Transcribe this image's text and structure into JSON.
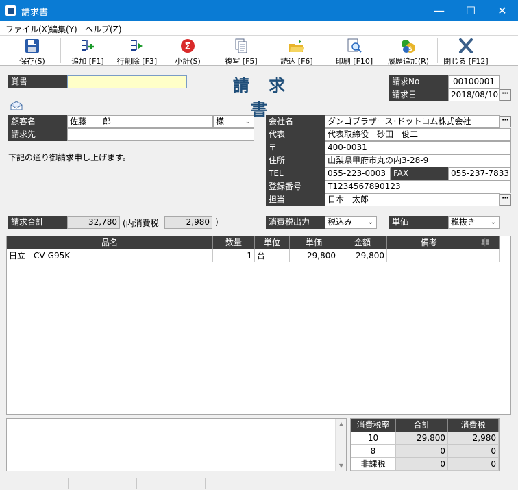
{
  "window": {
    "title": "請求書"
  },
  "menu": [
    "ファイル(X)",
    "編集(Y)",
    "ヘルプ(Z)"
  ],
  "toolbar": [
    {
      "label": "保存(S)",
      "icon": "save-icon"
    },
    {
      "label": "追加 [F1]",
      "icon": "add-row-icon"
    },
    {
      "label": "行削除 [F3]",
      "icon": "delete-row-icon"
    },
    {
      "label": "小計(S)",
      "icon": "sigma-icon"
    },
    {
      "label": "複写 [F5]",
      "icon": "copy-icon"
    },
    {
      "label": "読込 [F6]",
      "icon": "folder-open-icon"
    },
    {
      "label": "印刷 [F10]",
      "icon": "print-preview-icon"
    },
    {
      "label": "履歴追加(R)",
      "icon": "history-add-icon"
    },
    {
      "label": "閉じる [F12]",
      "icon": "close-x-icon"
    }
  ],
  "header": {
    "memo_label": "覚書",
    "memo_value": "",
    "doc_title": "請 求 書",
    "invoice_no_label": "請求No",
    "invoice_no": "00100001",
    "invoice_date_label": "請求日",
    "invoice_date": "2018/08/10"
  },
  "customer": {
    "name_label": "顧客名",
    "name": "佐藤　一郎",
    "honorific": "様",
    "billto_label": "請求先",
    "billto": "",
    "message": "下記の通り御請求申し上げます。"
  },
  "company": {
    "name_label": "会社名",
    "name": "ダンゴブラザース･ドットコム株式会社",
    "rep_label": "代表",
    "rep": "代表取締役　砂田　俊二",
    "zip_label": "〒",
    "zip": "400-0031",
    "addr_label": "住所",
    "addr": "山梨県甲府市丸の内3-28-9",
    "tel_label": "TEL",
    "tel": "055-223-0003",
    "fax_label": "FAX",
    "fax": "055-237-7833",
    "reg_label": "登録番号",
    "reg": "T1234567890123",
    "staff_label": "担当",
    "staff": "日本　太郎"
  },
  "totals": {
    "total_label": "請求合計",
    "total": "32,780",
    "tax_open": "(内消費税",
    "tax": "2,980",
    "tax_close": ")",
    "tax_output_label": "消費税出力",
    "tax_output": "税込み",
    "unit_price_label": "単価",
    "unit_price_mode": "税抜き"
  },
  "grid": {
    "columns": [
      "品名",
      "数量",
      "単位",
      "単価",
      "金額",
      "備考",
      "非"
    ],
    "rows": [
      [
        "日立　CV-G95K",
        "1",
        "台",
        "29,800",
        "29,800",
        "",
        ""
      ]
    ]
  },
  "tax_table": {
    "columns": [
      "消費税率",
      "合計",
      "消費税"
    ],
    "rows": [
      [
        "10",
        "29,800",
        "2,980"
      ],
      [
        "8",
        "0",
        "0"
      ],
      [
        "非課税",
        "0",
        "0"
      ]
    ]
  },
  "colors": {
    "title_bar": "#0a7bd4",
    "label_bg": "#3d3d3d",
    "memo_bg": "#ffffc8",
    "doc_title": "#1f4e79"
  }
}
